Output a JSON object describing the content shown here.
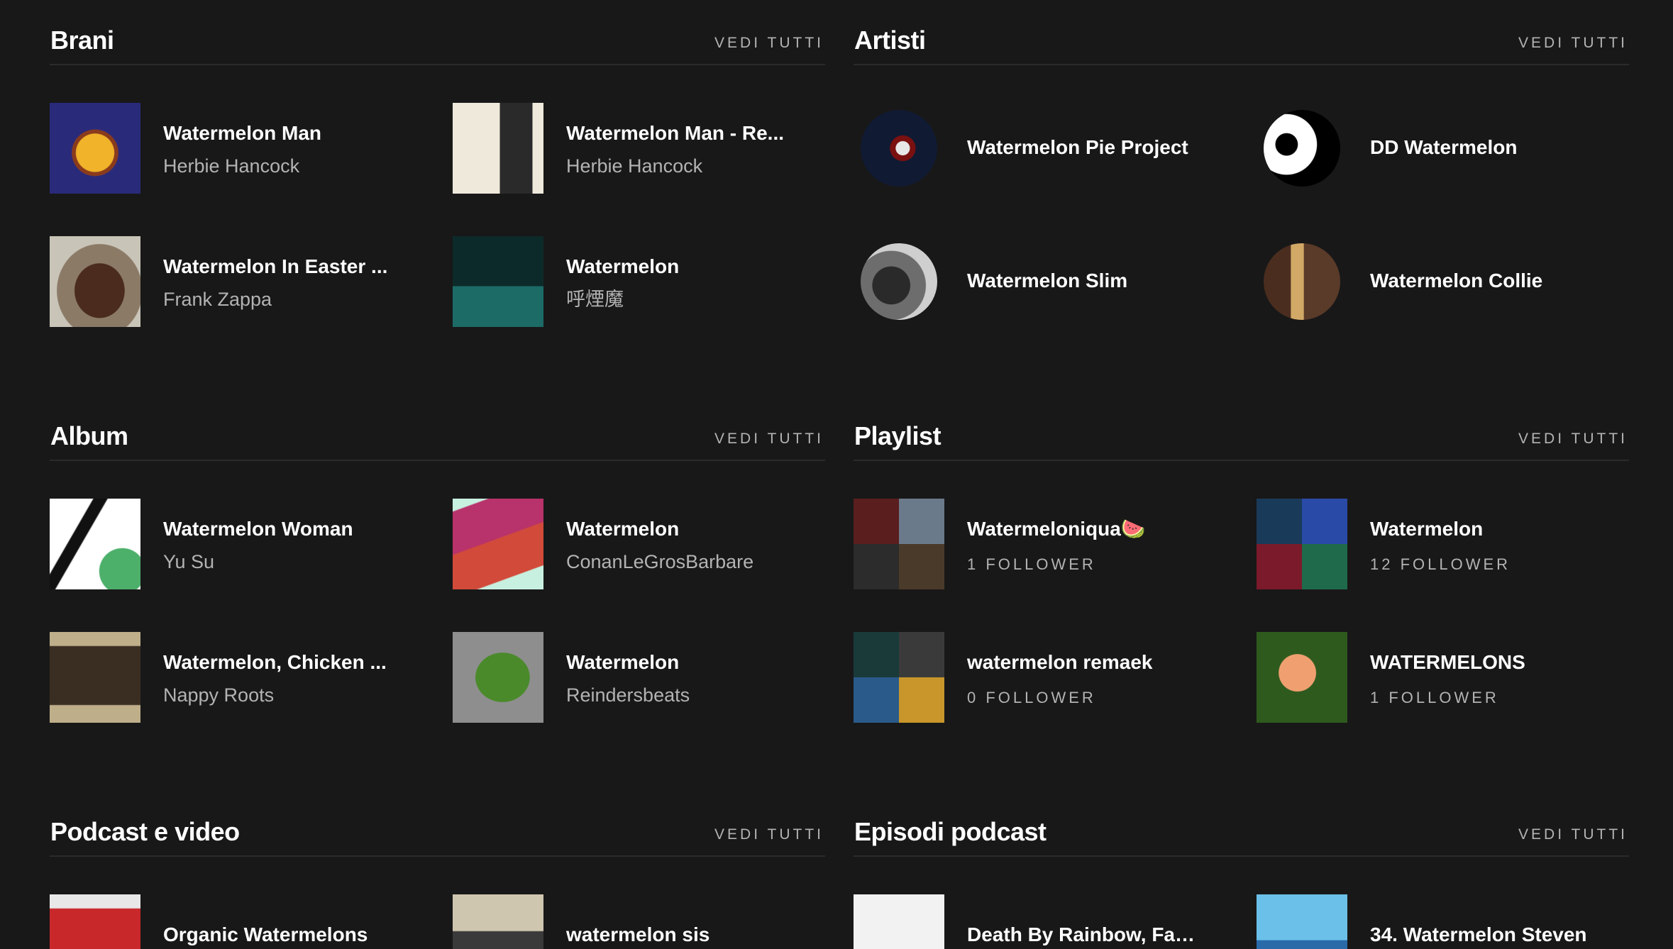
{
  "brani": {
    "title": "Brani",
    "see_all": "VEDI TUTTI",
    "items": [
      {
        "title": "Watermelon Man",
        "subtitle": "Herbie Hancock"
      },
      {
        "title": "Watermelon Man - Re...",
        "subtitle": "Herbie Hancock"
      },
      {
        "title": "Watermelon In Easter ...",
        "subtitle": "Frank Zappa"
      },
      {
        "title": "Watermelon",
        "subtitle": "呼煙魔"
      }
    ]
  },
  "artisti": {
    "title": "Artisti",
    "see_all": "VEDI TUTTI",
    "items": [
      {
        "title": "Watermelon Pie Project"
      },
      {
        "title": "DD Watermelon"
      },
      {
        "title": "Watermelon Slim"
      },
      {
        "title": "Watermelon Collie"
      }
    ]
  },
  "album": {
    "title": "Album",
    "see_all": "VEDI TUTTI",
    "items": [
      {
        "title": "Watermelon Woman",
        "subtitle": "Yu Su"
      },
      {
        "title": "Watermelon",
        "subtitle": "ConanLeGrosBarbare"
      },
      {
        "title": "Watermelon, Chicken ...",
        "subtitle": "Nappy Roots"
      },
      {
        "title": "Watermelon",
        "subtitle": "Reindersbeats"
      }
    ]
  },
  "playlist": {
    "title": "Playlist",
    "see_all": "VEDI TUTTI",
    "items": [
      {
        "title": "Watermeloniqua🍉",
        "subtitle": "1 FOLLOWER"
      },
      {
        "title": "Watermelon",
        "subtitle": "12 FOLLOWER"
      },
      {
        "title": "watermelon remaek",
        "subtitle": "0 FOLLOWER"
      },
      {
        "title": "WATERMELONS",
        "subtitle": "1 FOLLOWER"
      }
    ]
  },
  "podcast": {
    "title": "Podcast e video",
    "see_all": "VEDI TUTTI",
    "items": [
      {
        "title": "Organic Watermelons"
      },
      {
        "title": "watermelon sis"
      }
    ]
  },
  "episodi": {
    "title": "Episodi podcast",
    "see_all": "VEDI TUTTI",
    "items": [
      {
        "title": "Death By Rainbow, Fac..."
      },
      {
        "title": "34. Watermelon Steven"
      }
    ]
  }
}
